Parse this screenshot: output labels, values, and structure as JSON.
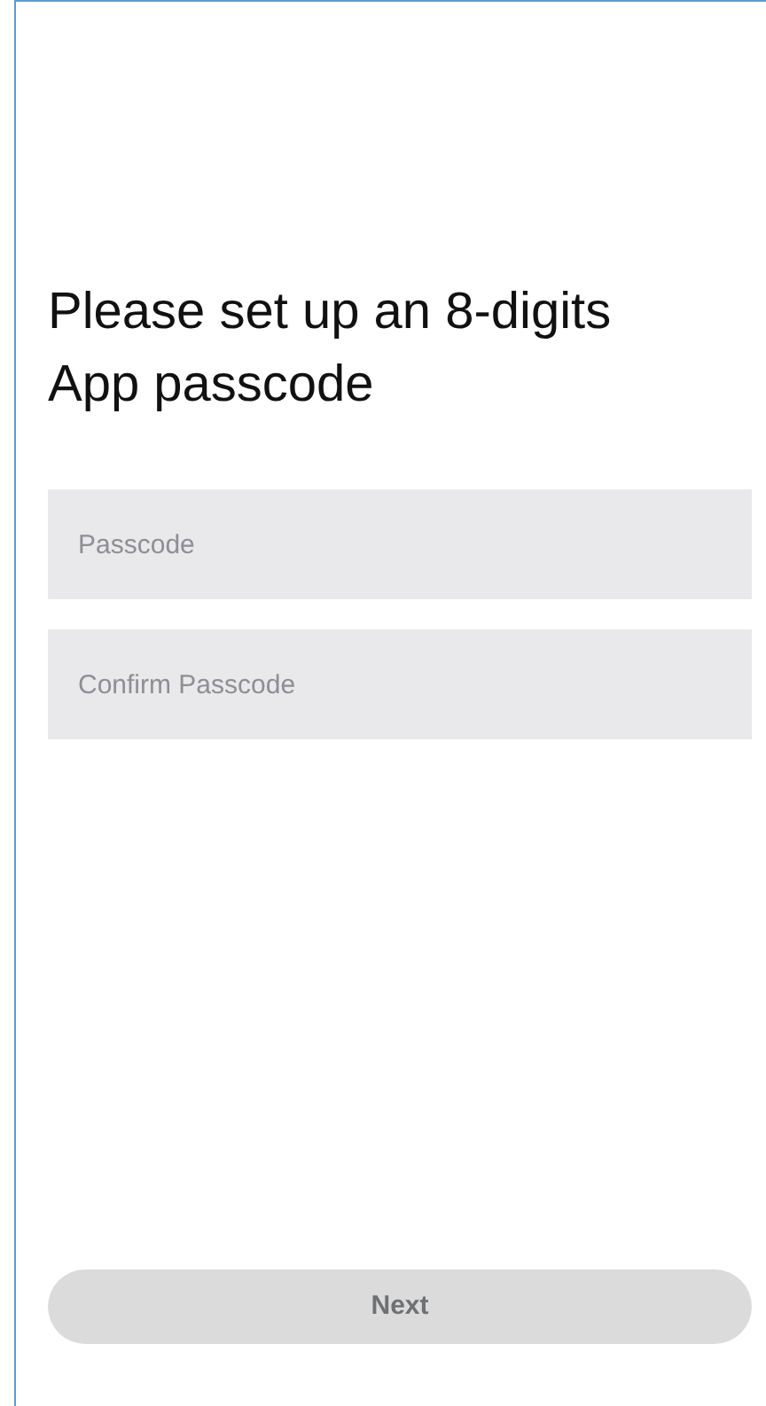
{
  "title": "Please set up an 8-digits App passcode",
  "fields": [
    {
      "placeholder": "Passcode"
    },
    {
      "placeholder": "Confirm Passcode"
    }
  ],
  "next_button": {
    "label": "Next",
    "disabled": true
  }
}
